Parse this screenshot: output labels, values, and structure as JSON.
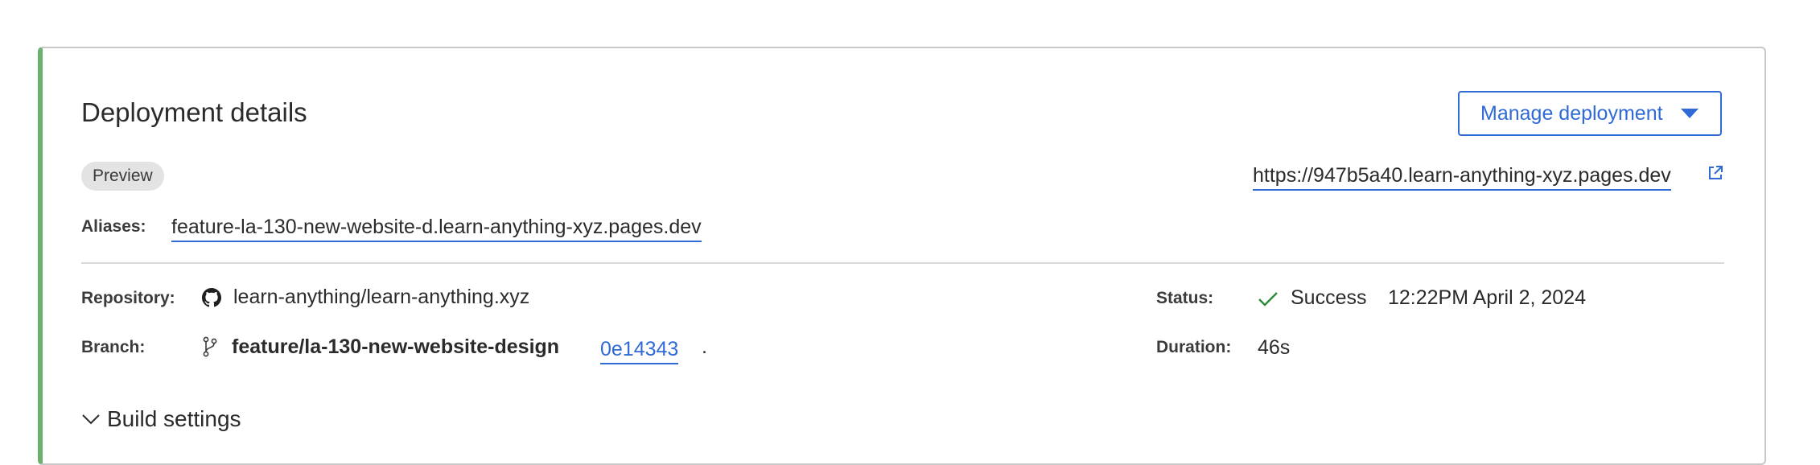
{
  "header": {
    "title": "Deployment details",
    "manage_button_label": "Manage deployment"
  },
  "environment_badge": "Preview",
  "deployment_url": "https://947b5a40.learn-anything-xyz.pages.dev",
  "aliases": {
    "label": "Aliases:",
    "value": "feature-la-130-new-website-d.learn-anything-xyz.pages.dev"
  },
  "repository": {
    "label": "Repository:",
    "value": "learn-anything/learn-anything.xyz"
  },
  "branch": {
    "label": "Branch:",
    "value": "feature/la-130-new-website-design",
    "commit": "0e14343",
    "trailing": "."
  },
  "status": {
    "label": "Status:",
    "value": "Success",
    "timestamp": "12:22PM April 2, 2024",
    "color": "#2e8a3a"
  },
  "duration": {
    "label": "Duration:",
    "value": "46s"
  },
  "build_settings_label": "Build settings",
  "colors": {
    "accent": "#2f6ad6",
    "card_left_border": "#6ab26b"
  }
}
